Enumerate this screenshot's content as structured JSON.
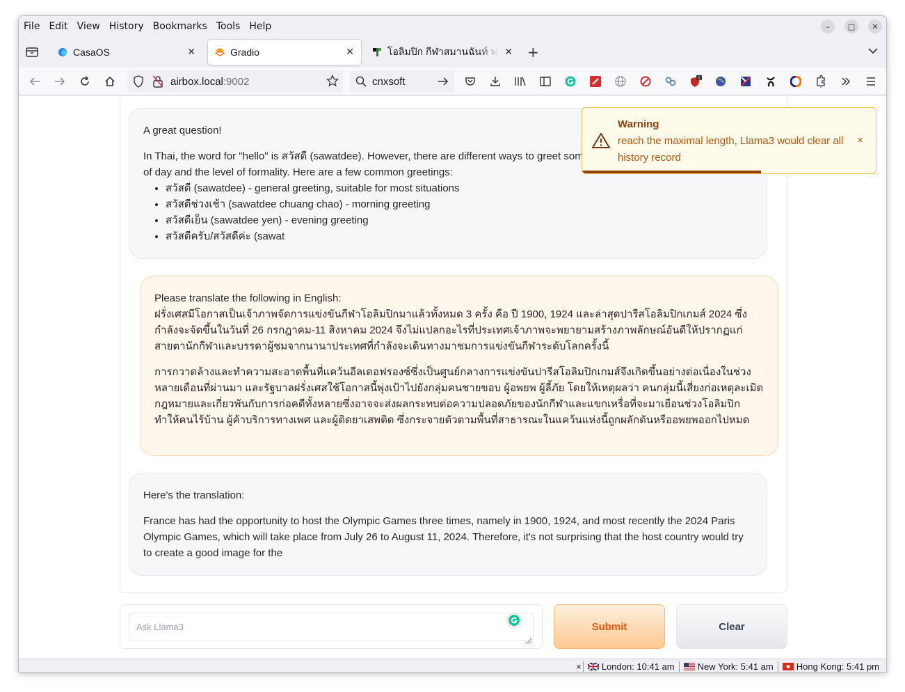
{
  "menu": [
    "File",
    "Edit",
    "View",
    "History",
    "Bookmarks",
    "Tools",
    "Help"
  ],
  "menu_underline": [
    "F",
    "E",
    "V",
    "s",
    "B",
    "T",
    "H"
  ],
  "window_controls": {
    "minimize": "–",
    "maximize": "□",
    "close": "✕"
  },
  "tabs": [
    {
      "title": "CasaOS",
      "icon": "casaos-icon",
      "active": false
    },
    {
      "title": "Gradio",
      "icon": "gradio-icon",
      "active": true
    },
    {
      "title": "โอลิมปิก กีฬาสมานฉันท์ ฟ",
      "icon": "thai-site-icon",
      "active": false
    }
  ],
  "url": {
    "host": "airbox.local",
    "port": ":9002"
  },
  "search": {
    "value": "cnxsoft"
  },
  "messages": {
    "bot1": {
      "greeting": "A great question!",
      "intro": "In Thai, the word for \"hello\" is สวัสดี (sawatdee). However, there are different ways to greet som",
      "intro_cont": "of day and the level of formality. Here are a few common greetings:",
      "items": [
        "สวัสดี (sawatdee) - general greeting, suitable for most situations",
        "สวัสดีช่วงเช้า (sawatdee chuang chao) - morning greeting",
        "สวัสดีเย็น (sawatdee yen) - evening greeting",
        "สวัสดีครับ/สวัสดีค่ะ (sawat"
      ]
    },
    "user": {
      "line1": "Please translate the following in English:",
      "para1": "ฝรั่งเศสมีโอกาสเป็นเจ้าภาพจัดการแข่งขันกีฬาโอลิมปิกมาแล้วทั้งหมด 3 ครั้ง คือ ปี 1900, 1924 และล่าสุดปารีสโอลิมปิกเกมส์ 2024 ซึ่งกำลังจะจัดขึ้นในวันที่ 26 กรกฎาคม-11 สิงหาคม 2024 จึงไม่แปลกอะไรที่ประเทศเจ้าภาพจะพยายามสร้างภาพลักษณ์อันดีให้ปรากฏแก่สายตานักกีฬาและบรรดาผู้ชมจากนานาประเทศที่กำลังจะเดินทางมาชมการแข่งขันกีฬาระดับโลกครั้งนี้",
      "para2": "การกวาดล้างและทำความสะอาดพื้นที่แคว้นอีลเดอฟรองซ์ซึ่งเป็นศูนย์กลางการแข่งขันปารีสโอลิมปิกเกมส์จึงเกิดขึ้นอย่างต่อเนื่องในช่วงหลายเดือนที่ผ่านมา และรัฐบาลฝรั่งเศสใช้โอกาสนี้พุ่งเป้าไปยังกลุ่มคนชายขอบ ผู้อพยพ ผู้ลี้ภัย โดยให้เหตุผลว่า คนกลุ่มนี้เสี่ยงก่อเหตุละเมิดกฎหมายและเกี่ยวพันกับการก่อคดีทั้งหลายซึ่งอาจจะส่งผลกระทบต่อความปลอดภัยของนักกีฬาและแขกเหรื่อที่จะมาเยือนช่วงโอลิมปิก ทำให้คนไร้บ้าน ผู้ค้าบริการทางเพศ และผู้ติดยาเสพติด ซึ่งกระจายตัวตามพื้นที่สาธารณะในแคว้นแห่งนี้ถูกผลักดันหรืออพยพออกไปหมด"
    },
    "bot2": {
      "line1": "Here's the translation:",
      "para1": "France has had the opportunity to host the Olympic Games three times, namely in 1900, 1924, and most recently the 2024 Paris Olympic Games, which will take place from July 26 to August 11, 2024. Therefore, it's not surprising that the host country would try to create a good image for the"
    }
  },
  "input": {
    "placeholder": "Ask Llama3"
  },
  "buttons": {
    "submit": "Submit",
    "clear": "Clear"
  },
  "toast": {
    "title": "Warning",
    "message": "reach the maximal length, Llama3 would clear all history record",
    "close": "×",
    "progress": 0.61
  },
  "clocks": [
    {
      "label": "London: 10:41 am",
      "flag": "uk-flag-icon"
    },
    {
      "label": "New York: 5:41 am",
      "flag": "us-flag-icon"
    },
    {
      "label": "Hong Kong: 5:41 pm",
      "flag": "hk-flag-icon"
    }
  ],
  "status_close": "×",
  "colors": {
    "accent": "#ea580c",
    "warning_border": "#f0c04c",
    "warning_text": "#b45309"
  }
}
